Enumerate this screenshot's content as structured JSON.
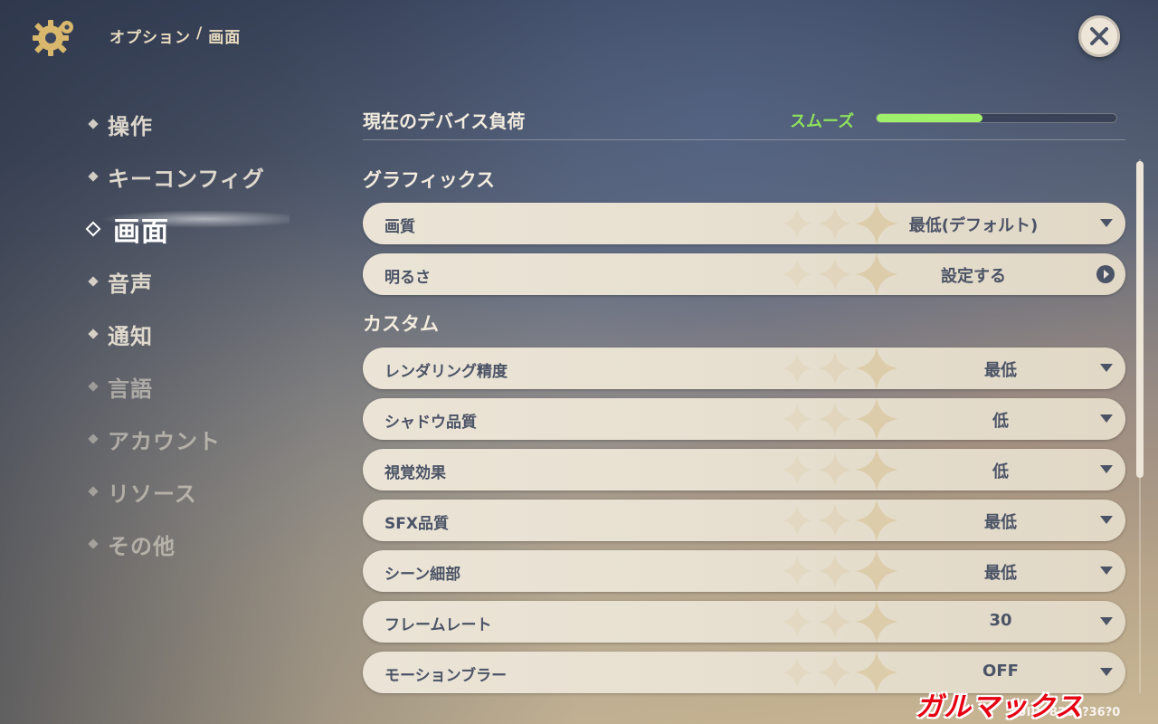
{
  "header": {
    "breadcrumb_parent": "オプション",
    "breadcrumb_sep": "/",
    "breadcrumb_current": "画面"
  },
  "nav": {
    "items": [
      {
        "label": "操作"
      },
      {
        "label": "キーコンフィグ"
      },
      {
        "label": "画面"
      },
      {
        "label": "音声"
      },
      {
        "label": "通知"
      },
      {
        "label": "言語"
      },
      {
        "label": "アカウント"
      },
      {
        "label": "リソース"
      },
      {
        "label": "その他"
      }
    ],
    "active": "画面"
  },
  "device_load": {
    "label": "現在のデバイス負荷",
    "status": "スムーズ",
    "level": 0.44,
    "status_color": "#8ee35a"
  },
  "sections": {
    "graphics_title": "グラフィックス",
    "custom_title": "カスタム"
  },
  "graphics": {
    "quality": {
      "label": "画質",
      "value": "最低(デフォルト)"
    },
    "brightness": {
      "label": "明るさ",
      "value": "設定する"
    }
  },
  "custom": {
    "rows": [
      {
        "label": "レンダリング精度",
        "value": "最低"
      },
      {
        "label": "シャドウ品質",
        "value": "低"
      },
      {
        "label": "視覚効果",
        "value": "低"
      },
      {
        "label": "SFX品質",
        "value": "最低"
      },
      {
        "label": "シーン細部",
        "value": "最低"
      },
      {
        "label": "フレームレート",
        "value": "30"
      },
      {
        "label": "モーションブラー",
        "value": "OFF"
      }
    ]
  },
  "footer": {
    "uid": "UID: 8200?36?0",
    "watermark": "ガルマックス"
  },
  "icons": {
    "settings": "gear-icon",
    "close": "close-icon",
    "dropdown": "caret-down-icon",
    "go": "arrow-right-circle-icon"
  }
}
